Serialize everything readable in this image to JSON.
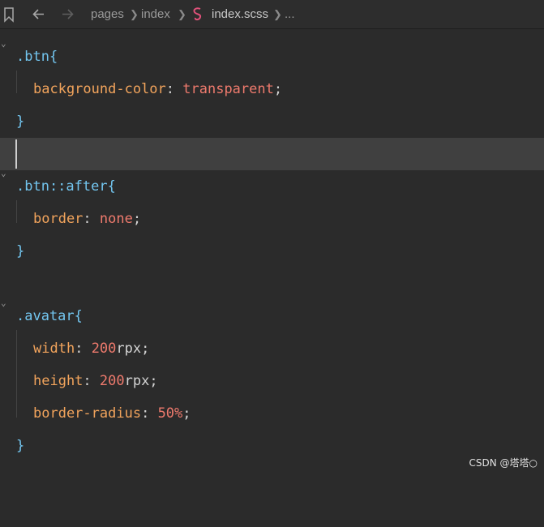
{
  "breadcrumb": {
    "items": [
      "pages",
      "index"
    ],
    "file": "index.scss",
    "more": "..."
  },
  "icons": {
    "bookmark": "bookmark-icon",
    "back": "arrow-left-icon",
    "forward": "arrow-right-icon",
    "file_type": "sass-icon"
  },
  "code": {
    "l1": {
      "selector": ".btn",
      "open": "{"
    },
    "l2": {
      "prop": "background-color",
      "colon": ":",
      "value": "transparent",
      "semi": ";"
    },
    "l3": {
      "close": "}"
    },
    "l5": {
      "selector": ".btn::after",
      "open": "{"
    },
    "l6": {
      "prop": "border",
      "colon": ":",
      "value": "none",
      "semi": ";"
    },
    "l7": {
      "close": "}"
    },
    "l9": {
      "selector": ".avatar",
      "open": "{"
    },
    "l10": {
      "prop": "width",
      "colon": ":",
      "num": "200",
      "unit": "rpx",
      "semi": ";"
    },
    "l11": {
      "prop": "height",
      "colon": ":",
      "num": "200",
      "unit": "rpx",
      "semi": ";"
    },
    "l12": {
      "prop": "border-radius",
      "colon": ":",
      "num": "50%",
      "semi": ";"
    },
    "l13": {
      "close": "}"
    }
  },
  "watermark": "CSDN @塔塔○"
}
